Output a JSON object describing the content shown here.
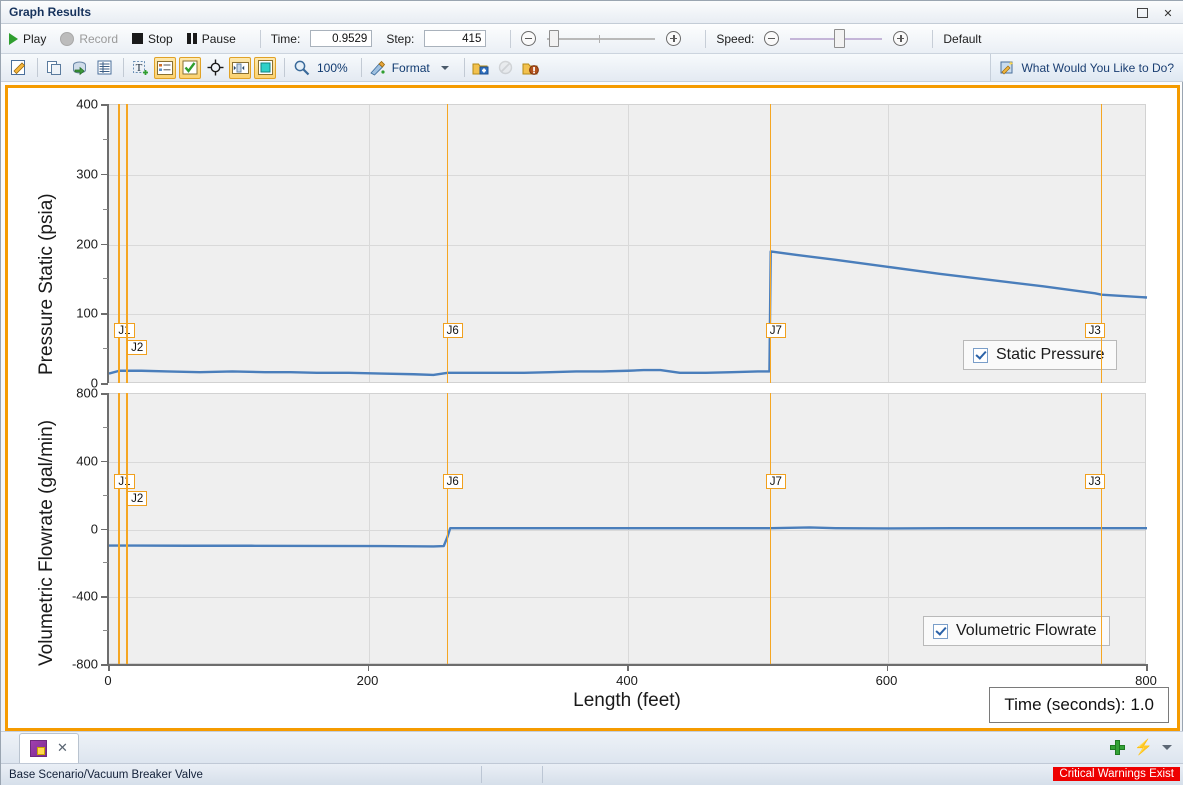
{
  "window": {
    "title": "Graph Results",
    "buttons": [
      {
        "name": "maximize-button",
        "label": "□"
      },
      {
        "name": "close-button",
        "label": "✕"
      }
    ]
  },
  "toolbar_playback": {
    "play_label": "Play",
    "record_label": "Record",
    "stop_label": "Stop",
    "pause_label": "Pause",
    "time_label": "Time:",
    "time_value": "0.9529",
    "step_label": "Step:",
    "step_value": "415",
    "speed_label": "Speed:",
    "default_label": "Default",
    "minus_icon": "minus-circle-icon",
    "plus_icon": "plus-circle-icon"
  },
  "toolbar_tools": {
    "zoom_level": "100%",
    "format_label": "Format",
    "what_would_you_like": "What Would You Like to Do?",
    "icons": [
      {
        "name": "edit-annotate-icon",
        "active": false
      },
      {
        "name": "copy-icon",
        "active": false
      },
      {
        "name": "refresh-data-icon",
        "active": false
      },
      {
        "name": "table-view-icon",
        "active": false
      },
      {
        "name": "add-text-icon",
        "active": false
      },
      {
        "name": "legend-toggle-icon",
        "active": true
      },
      {
        "name": "checkbox-toggle-icon",
        "active": true
      },
      {
        "name": "crosshair-icon",
        "active": false
      },
      {
        "name": "animation-bar-icon",
        "active": true
      },
      {
        "name": "fill-color-icon",
        "active": true
      },
      {
        "name": "zoom-magnifier-icon",
        "active": false
      },
      {
        "name": "format-pencil-icon",
        "active": false
      },
      {
        "name": "add-folder-icon",
        "active": false
      },
      {
        "name": "disabled-icon",
        "active": false
      },
      {
        "name": "warning-folder-icon",
        "active": false
      }
    ]
  },
  "chart_data": [
    {
      "type": "line",
      "id": "static-pressure",
      "title": "",
      "xlabel": "Length (feet)",
      "ylabel": "Pressure Static (psia)",
      "xlim": [
        0,
        800
      ],
      "ylim": [
        0,
        400
      ],
      "xticks": [
        0,
        200,
        400,
        600,
        800
      ],
      "yticks": [
        0,
        100,
        200,
        300,
        400
      ],
      "y_minor_ticks": [
        50,
        150,
        250,
        350
      ],
      "grid": true,
      "legend": {
        "label": "Static Pressure",
        "checked": true,
        "position": "bottom-right"
      },
      "line_color": "#4a7ebb",
      "junctions": [
        {
          "label": "J1",
          "x": 8
        },
        {
          "label": "J2",
          "x": 14
        },
        {
          "label": "J6",
          "x": 261
        },
        {
          "label": "J7",
          "x": 510
        },
        {
          "label": "J3",
          "x": 765
        }
      ],
      "x": [
        0,
        8,
        14,
        25,
        45,
        70,
        95,
        120,
        140,
        160,
        185,
        210,
        235,
        250,
        261,
        280,
        300,
        320,
        340,
        360,
        380,
        400,
        412,
        425,
        440,
        460,
        480,
        500,
        509,
        510,
        530,
        560,
        600,
        640,
        680,
        720,
        760,
        765,
        800
      ],
      "y": [
        15,
        19,
        19,
        19,
        18,
        17,
        18,
        17,
        17,
        16,
        16,
        15,
        14,
        13,
        16,
        16,
        16,
        16,
        17,
        18,
        18,
        19,
        20,
        20,
        16,
        16,
        17,
        18,
        18,
        190,
        185,
        178,
        168,
        158,
        149,
        140,
        130,
        128,
        124
      ]
    },
    {
      "type": "line",
      "id": "volumetric-flowrate",
      "title": "",
      "xlabel": "Length (feet)",
      "ylabel": "Volumetric Flowrate (gal/min)",
      "xlim": [
        0,
        800
      ],
      "ylim": [
        -800,
        800
      ],
      "xticks": [
        0,
        200,
        400,
        600,
        800
      ],
      "yticks": [
        -800,
        -400,
        0,
        400,
        800
      ],
      "y_minor_ticks": [
        -600,
        -200,
        200,
        600
      ],
      "grid": true,
      "legend": {
        "label": "Volumetric Flowrate",
        "checked": true,
        "position": "bottom-right"
      },
      "line_color": "#4a7ebb",
      "junctions": [
        {
          "label": "J1",
          "x": 8
        },
        {
          "label": "J2",
          "x": 14
        },
        {
          "label": "J6",
          "x": 261
        },
        {
          "label": "J7",
          "x": 510
        },
        {
          "label": "J3",
          "x": 765
        }
      ],
      "x": [
        0,
        20,
        60,
        110,
        160,
        210,
        250,
        258,
        261,
        263,
        300,
        350,
        400,
        450,
        500,
        510,
        540,
        560,
        600,
        650,
        700,
        750,
        765,
        800
      ],
      "y": [
        -95,
        -95,
        -96,
        -96,
        -97,
        -98,
        -100,
        -98,
        -40,
        8,
        8,
        8,
        8,
        8,
        8,
        8,
        12,
        8,
        6,
        8,
        8,
        8,
        8,
        8
      ]
    }
  ],
  "annotations": {
    "time_box": "Time (seconds): 1.0"
  },
  "tabs": [
    {
      "name": "graph-results-tab",
      "icon": "graph-icon",
      "close": "✕"
    }
  ],
  "tab_actions": {
    "add_icon": "plus-icon",
    "bolt_icon": "bolt-icon",
    "dropdown_icon": "chevron-down-icon"
  },
  "statusbar": {
    "scenario": "Base Scenario/Vacuum Breaker Valve",
    "warning": "Critical Warnings Exist"
  },
  "colors": {
    "accent_orange": "#f59b00",
    "line_blue": "#4a7ebb",
    "warning_red": "#ee0000",
    "junction_orange": "#f5a623"
  }
}
